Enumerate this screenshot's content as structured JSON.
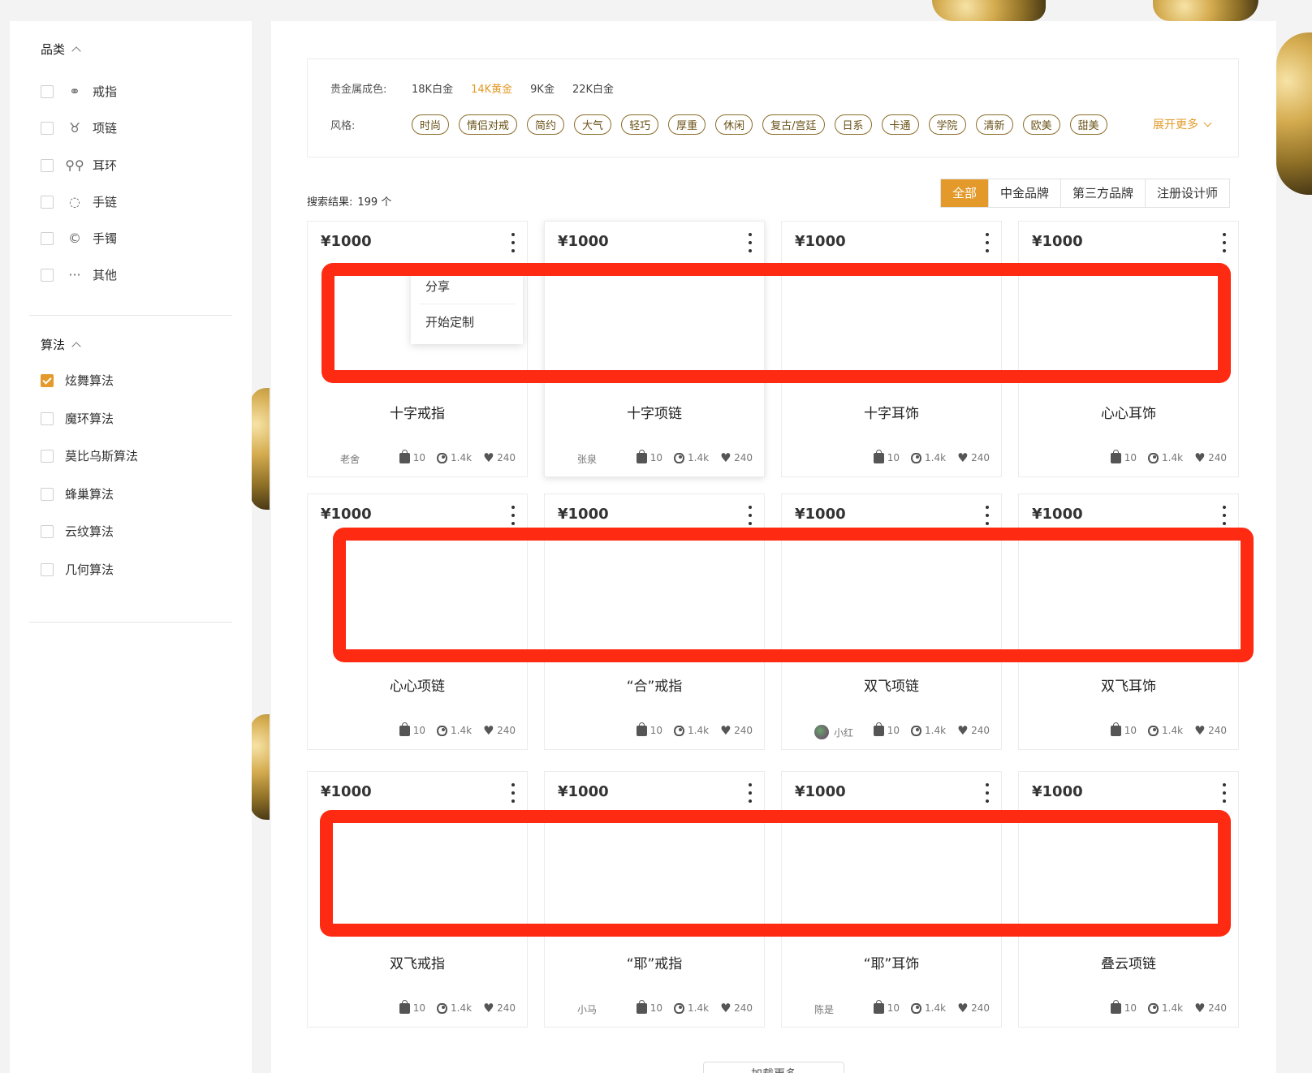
{
  "sidebar": {
    "category_title": "品类",
    "categories": [
      {
        "label": "戒指",
        "icon": "ring-icon"
      },
      {
        "label": "项链",
        "icon": "necklace-icon"
      },
      {
        "label": "耳环",
        "icon": "earring-icon"
      },
      {
        "label": "手链",
        "icon": "bracelet-icon"
      },
      {
        "label": "手镯",
        "icon": "bangle-icon"
      },
      {
        "label": "其他",
        "icon": "more-dots-icon"
      }
    ],
    "algorithm_title": "算法",
    "algorithms": [
      {
        "label": "炫舞算法",
        "checked": true
      },
      {
        "label": "魔环算法",
        "checked": false
      },
      {
        "label": "莫比乌斯算法",
        "checked": false
      },
      {
        "label": "蜂巢算法",
        "checked": false
      },
      {
        "label": "云纹算法",
        "checked": false
      },
      {
        "label": "几何算法",
        "checked": false
      }
    ]
  },
  "filters": {
    "metal_label": "贵金属成色:",
    "metals": [
      "18K白金",
      "14K黄金",
      "9K金",
      "22K白金"
    ],
    "metal_active": "14K黄金",
    "style_label": "风格:",
    "styles": [
      "时尚",
      "情侣对戒",
      "简约",
      "大气",
      "轻巧",
      "厚重",
      "休闲",
      "复古/宫廷",
      "日系",
      "卡通",
      "学院",
      "清新",
      "欧美",
      "甜美"
    ],
    "expand_label": "展开更多"
  },
  "results": {
    "label": "搜索结果:",
    "count": "199 个"
  },
  "tabs": [
    {
      "label": "全部",
      "active": true
    },
    {
      "label": "中金品牌",
      "active": false
    },
    {
      "label": "第三方品牌",
      "active": false
    },
    {
      "label": "注册设计师",
      "active": false
    }
  ],
  "popup_menu": {
    "share": "分享",
    "customize": "开始定制"
  },
  "products": [
    {
      "price": "¥1000",
      "name": "十字戒指",
      "author": "老舍",
      "bag": "10",
      "views": "1.4k",
      "likes": "240"
    },
    {
      "price": "¥1000",
      "name": "十字项链",
      "author": "张泉",
      "bag": "10",
      "views": "1.4k",
      "likes": "240"
    },
    {
      "price": "¥1000",
      "name": "十字耳饰",
      "author": "",
      "bag": "10",
      "views": "1.4k",
      "likes": "240"
    },
    {
      "price": "¥1000",
      "name": "心心耳饰",
      "author": "",
      "bag": "10",
      "views": "1.4k",
      "likes": "240"
    },
    {
      "price": "¥1000",
      "name": "心心项链",
      "author": "",
      "bag": "10",
      "views": "1.4k",
      "likes": "240"
    },
    {
      "price": "¥1000",
      "name": "“合”戒指",
      "author": "",
      "bag": "10",
      "views": "1.4k",
      "likes": "240"
    },
    {
      "price": "¥1000",
      "name": "双飞项链",
      "author": "小红",
      "bag": "10",
      "views": "1.4k",
      "likes": "240"
    },
    {
      "price": "¥1000",
      "name": "双飞耳饰",
      "author": "",
      "bag": "10",
      "views": "1.4k",
      "likes": "240"
    },
    {
      "price": "¥1000",
      "name": "双飞戒指",
      "author": "",
      "bag": "10",
      "views": "1.4k",
      "likes": "240"
    },
    {
      "price": "¥1000",
      "name": "“耶”戒指",
      "author": "小马",
      "bag": "10",
      "views": "1.4k",
      "likes": "240"
    },
    {
      "price": "¥1000",
      "name": "“耶”耳饰",
      "author": "陈是",
      "bag": "10",
      "views": "1.4k",
      "likes": "240"
    },
    {
      "price": "¥1000",
      "name": "叠云项链",
      "author": "",
      "bag": "10",
      "views": "1.4k",
      "likes": "240"
    }
  ],
  "load_more": "加载更多",
  "colors": {
    "accent": "#e39a2a",
    "annotation": "#ff2a12"
  }
}
